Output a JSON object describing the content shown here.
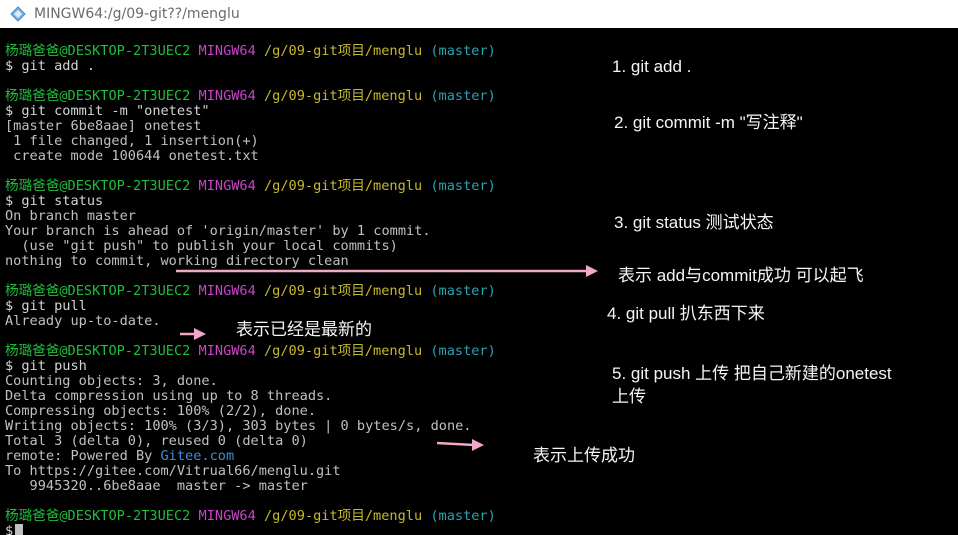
{
  "window": {
    "title": "MINGW64:/g/09-git??/menglu",
    "icon": "git-bash-icon"
  },
  "prompt": {
    "user": "杨璐爸爸@DESKTOP-2T3UEC2",
    "system": "MINGW64",
    "path": "/g/09-git项目/menglu",
    "branch": "(master)"
  },
  "blocks": [
    {
      "command": "$ git add .",
      "output": []
    },
    {
      "command": "$ git commit -m \"onetest\"",
      "output": [
        "[master 6be8aae] onetest",
        " 1 file changed, 1 insertion(+)",
        " create mode 100644 onetest.txt"
      ]
    },
    {
      "command": "$ git status",
      "output": [
        "On branch master",
        "Your branch is ahead of 'origin/master' by 1 commit.",
        "  (use \"git push\" to publish your local commits)",
        "nothing to commit, working directory clean"
      ]
    },
    {
      "command": "$ git pull",
      "output": [
        "Already up-to-date."
      ]
    },
    {
      "command": "$ git push",
      "output": [
        "Counting objects: 3, done.",
        "Delta compression using up to 8 threads.",
        "Compressing objects: 100% (2/2), done.",
        "Writing objects: 100% (3/3), 303 bytes | 0 bytes/s, done.",
        "Total 3 (delta 0), reused 0 (delta 0)"
      ],
      "remote_prefix": "remote: Powered By ",
      "remote_link": "Gitee.com",
      "tail": [
        "To https://gitee.com/Vitrual66/menglu.git",
        "   9945320..6be8aae  master -> master"
      ]
    }
  ],
  "final_prompt": "$",
  "annotations": {
    "add": "1.  git add .",
    "commit": "2. git  commit  -m \"写注释\"",
    "status": "3. git  status 测试状态",
    "status_result": "表示 add与commit成功 可以起飞",
    "pull": "4. git pull 扒东西下来",
    "pull_result": "表示已经是最新的",
    "push_line1": "5.  git push  上传 把自己新建的onetest",
    "push_line2": "上传",
    "push_result": "表示上传成功"
  },
  "colors": {
    "background": "#000000",
    "prompt_user": "#1ebd3a",
    "prompt_system": "#c845c8",
    "prompt_path": "#c6b92c",
    "prompt_branch": "#2aa1b3",
    "text": "#c0c0c0",
    "link": "#3f8bd8",
    "arrow": "#f2a6c8"
  }
}
